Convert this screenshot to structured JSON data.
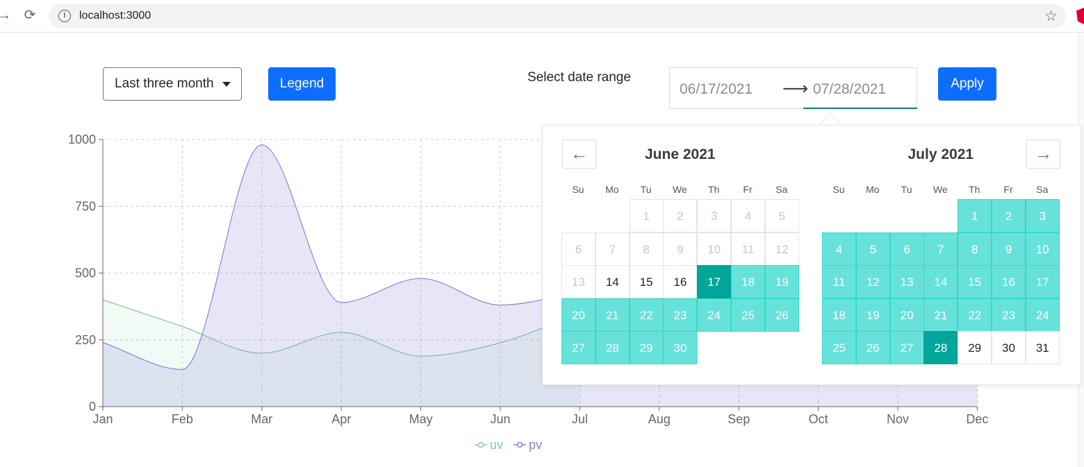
{
  "browser": {
    "url": "localhost:3000",
    "back_icon": "arrow-right-icon",
    "reload_icon": "reload-icon",
    "info_icon": "info-icon",
    "star_icon": "star-icon"
  },
  "toolbar": {
    "period_label": "Last three month",
    "legend_label": "Legend",
    "range_label": "Select date range",
    "start_date": "06/17/2021",
    "range_arrow": "⟶",
    "end_date": "07/28/2021",
    "apply_label": "Apply"
  },
  "calendar": {
    "prev_icon": "←",
    "next_icon": "→",
    "weekdays": [
      "Su",
      "Mo",
      "Tu",
      "We",
      "Th",
      "Fr",
      "Sa"
    ],
    "months": [
      {
        "title": "June 2021",
        "first_weekday": 2,
        "days": 30,
        "blocked_until": 13,
        "range_start": 17,
        "range_end": 30,
        "start_edge": 17,
        "end_edge": null
      },
      {
        "title": "July 2021",
        "first_weekday": 4,
        "days": 31,
        "blocked_until": 0,
        "range_start": 1,
        "range_end": 28,
        "start_edge": null,
        "end_edge": 28
      }
    ],
    "colors": {
      "range": "#66e2da",
      "edge": "#00a699"
    }
  },
  "chart_data": {
    "type": "area",
    "categories": [
      "Jan",
      "Feb",
      "Mar",
      "Apr",
      "May",
      "Jun",
      "Jul",
      "Aug",
      "Sep",
      "Oct",
      "Nov",
      "Dec"
    ],
    "series": [
      {
        "name": "uv",
        "color": "#82ca9d",
        "values": [
          400,
          300,
          200,
          278,
          189,
          239,
          349,
          null,
          null,
          null,
          null,
          null
        ]
      },
      {
        "name": "pv",
        "color": "#8884d8",
        "values": [
          240,
          139,
          980,
          390,
          480,
          380,
          430,
          null,
          null,
          null,
          null,
          null
        ]
      }
    ],
    "ylim": [
      0,
      1000
    ],
    "yticks": [
      0,
      250,
      500,
      750,
      1000
    ],
    "grid": true,
    "legend_position": "bottom"
  }
}
